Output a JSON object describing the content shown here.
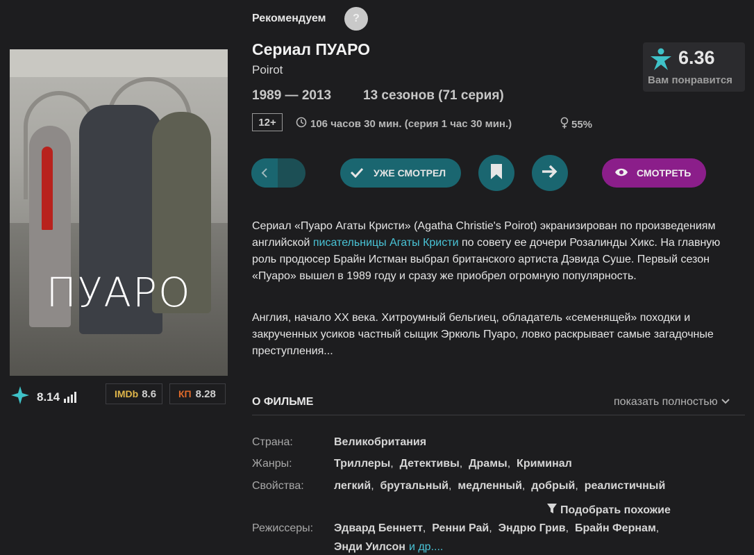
{
  "header": {
    "recommend_label": "Рекомендуем",
    "help_label": "?",
    "title": "Сериал ПУАРО",
    "original_title": "Poirot",
    "years": "1989 — 2013",
    "seasons": "13 сезонов (71 серия)",
    "age": "12+",
    "duration": "106 часов 30 мин. (серия 1 час 30 мин.)",
    "audience_female": "55%"
  },
  "score": {
    "value": "6.36",
    "caption": "Вам понравится"
  },
  "poster": {
    "title_text": "ПУАРО"
  },
  "ratings": {
    "site_value": "8.14",
    "imdb_label": "IMDb",
    "imdb_value": "8.6",
    "kp_label": "КП",
    "kp_value": "8.28"
  },
  "actions": {
    "back_icon": "chevron-left-icon",
    "seen_label": "УЖЕ СМОТРЕЛ",
    "watch_label": "СМОТРЕТЬ"
  },
  "description": {
    "p1_before": "Сериал «Пуаро Агаты Кристи» (Agatha Christie's Poirot) экранизирован по произведениям английской ",
    "p1_link": "писательницы Агаты Кристи",
    "p1_after": " по совету ее дочери Розалинды Хикс. На главную роль продюсер Брайн Истман выбрал британского артиста Дэвида Суше. Первый сезон «Пуаро» вышел в 1989 году и сразу же приобрел огромную популярность.",
    "p2": "Англия, начало XX века. Хитроумный бельгиец, обладатель «семенящей» походки и закрученных усиков частный сыщик Эркюль Пуаро, ловко раскрывает самые загадочные преступления..."
  },
  "about": {
    "title": "О ФИЛЬМЕ",
    "show_more": "показать полностью",
    "country_label": "Страна:",
    "country": "Великобритания",
    "genres_label": "Жанры:",
    "genres": [
      "Триллеры",
      "Детективы",
      "Драмы",
      "Криминал"
    ],
    "props_label": "Свойства:",
    "props": [
      "легкий",
      "брутальный",
      "медленный",
      "добрый",
      "реалистичный"
    ],
    "similar_label": "Подобрать похожие",
    "directors_label": "Режиссеры:",
    "directors": [
      "Эдвард Беннетт",
      "Ренни Рай",
      "Эндрю Грив",
      "Брайн Фернам"
    ],
    "directors_line2": "Энди Уилсон",
    "directors_more": "и др...."
  },
  "colors": {
    "teal": "#1a6670",
    "purple": "#8b1e8a",
    "link": "#49c3d6",
    "star": "#3fc2c8"
  }
}
